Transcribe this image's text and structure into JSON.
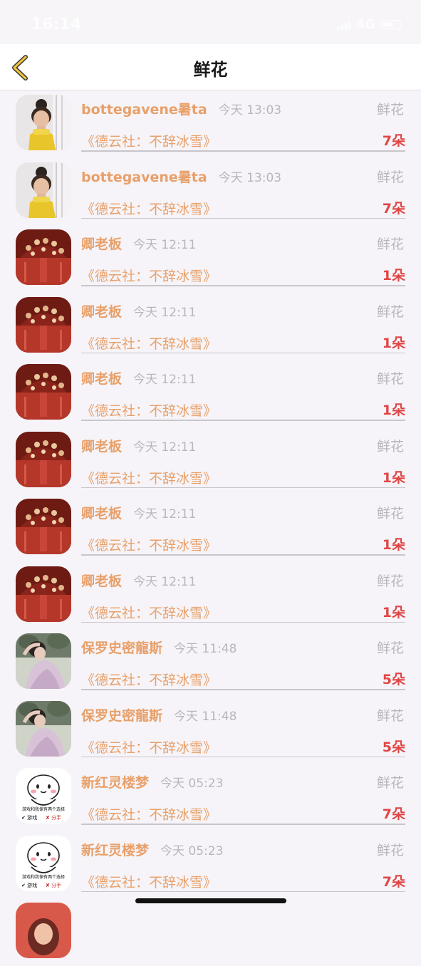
{
  "status": {
    "time": "16:14",
    "network": "4G"
  },
  "nav": {
    "title": "鲜花"
  },
  "colors": {
    "accent": "#e8a06a",
    "count": "#e04646",
    "muted": "#b9b6bb"
  },
  "rows": [
    {
      "avatar": "child-yellow",
      "name": "bottegavene暑ta",
      "time": "今天 13:03",
      "type": "鲜花",
      "title": "《德云社：不辞冰雪》",
      "count": "7朵"
    },
    {
      "avatar": "child-yellow",
      "name": "bottegavene暑ta",
      "time": "今天 13:03",
      "type": "鲜花",
      "title": "《德云社：不辞冰雪》",
      "count": "7朵"
    },
    {
      "avatar": "red-headdress",
      "name": "卿老板",
      "time": "今天 12:11",
      "type": "鲜花",
      "title": "《德云社：不辞冰雪》",
      "count": "1朵"
    },
    {
      "avatar": "red-headdress",
      "name": "卿老板",
      "time": "今天 12:11",
      "type": "鲜花",
      "title": "《德云社：不辞冰雪》",
      "count": "1朵"
    },
    {
      "avatar": "red-headdress",
      "name": "卿老板",
      "time": "今天 12:11",
      "type": "鲜花",
      "title": "《德云社：不辞冰雪》",
      "count": "1朵"
    },
    {
      "avatar": "red-headdress",
      "name": "卿老板",
      "time": "今天 12:11",
      "type": "鲜花",
      "title": "《德云社：不辞冰雪》",
      "count": "1朵"
    },
    {
      "avatar": "red-headdress",
      "name": "卿老板",
      "time": "今天 12:11",
      "type": "鲜花",
      "title": "《德云社：不辞冰雪》",
      "count": "1朵"
    },
    {
      "avatar": "red-headdress",
      "name": "卿老板",
      "time": "今天 12:11",
      "type": "鲜花",
      "title": "《德云社：不辞冰雪》",
      "count": "1朵"
    },
    {
      "avatar": "woman-dress",
      "name": "保罗史密龍斯",
      "time": "今天 11:48",
      "type": "鲜花",
      "title": "《德云社：不辞冰雪》",
      "count": "5朵"
    },
    {
      "avatar": "woman-dress",
      "name": "保罗史密龍斯",
      "time": "今天 11:48",
      "type": "鲜花",
      "title": "《德云社：不辞冰雪》",
      "count": "5朵"
    },
    {
      "avatar": "cartoon-meme",
      "name": "新红灵楼梦",
      "time": "今天 05:23",
      "type": "鲜花",
      "title": "《德云社：不辞冰雪》",
      "count": "7朵",
      "meme_text": "游戏和我保有两个选择",
      "meme_opt1": "✔ 游戏",
      "meme_opt2": "✘ 分手"
    },
    {
      "avatar": "cartoon-meme",
      "name": "新红灵楼梦",
      "time": "今天 05:23",
      "type": "鲜花",
      "title": "《德云社：不辞冰雪》",
      "count": "7朵",
      "meme_text": "游戏和我保有两个选择",
      "meme_opt1": "✔ 游戏",
      "meme_opt2": "✘ 分手"
    },
    {
      "avatar": "red-portrait",
      "name": "",
      "time": "",
      "type": "",
      "title": "",
      "count": ""
    }
  ]
}
